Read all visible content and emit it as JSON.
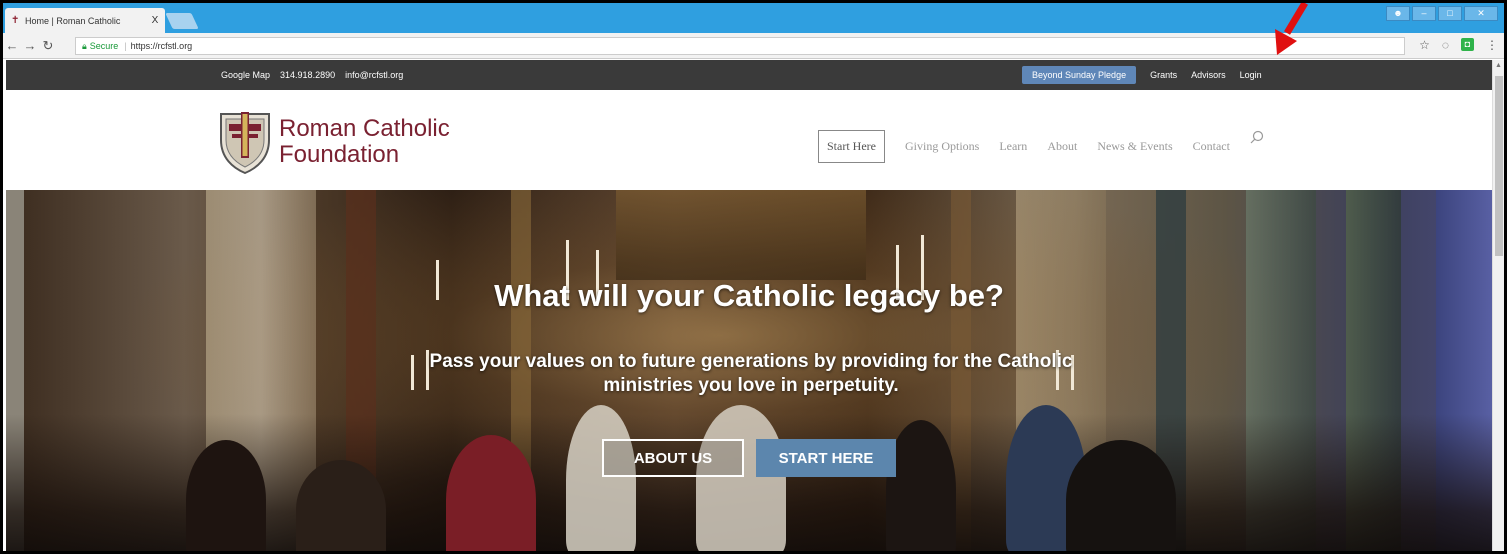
{
  "browser": {
    "tab_title": "Home | Roman Catholic",
    "tab_close": "X",
    "secure_label": "Secure",
    "url": "https://rcfstl.org"
  },
  "topbar": {
    "google_map": "Google Map",
    "phone": "314.918.2890",
    "email": "info@rcfstl.org",
    "pledge": "Beyond Sunday Pledge",
    "grants": "Grants",
    "advisors": "Advisors",
    "login": "Login"
  },
  "logo": {
    "line1": "Roman Catholic",
    "line2": "Foundation"
  },
  "menu": {
    "start_here": "Start Here",
    "giving_options": "Giving Options",
    "learn": "Learn",
    "about": "About",
    "news_events": "News & Events",
    "contact": "Contact"
  },
  "hero": {
    "headline": "What will your Catholic legacy be?",
    "subline": "Pass your values on to future generations by providing for the Catholic ministries you love in perpetuity.",
    "about_button": "ABOUT US",
    "start_button": "START HERE"
  },
  "colors": {
    "chrome_blue": "#2f9fe0",
    "topbar_bg": "#3a3a3a",
    "pledge_bg": "#5f87b8",
    "brand": "#7a2131",
    "start_btn": "#5c86ad",
    "annotation_arrow": "#e01010"
  }
}
